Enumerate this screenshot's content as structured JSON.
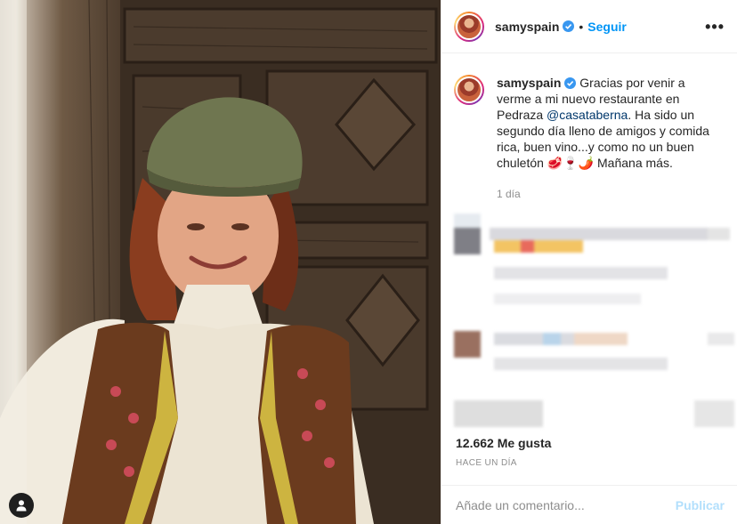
{
  "post": {
    "username": "samyspain",
    "verified": true,
    "separator": "•",
    "follow_label": "Seguir",
    "more_icon": "more-options-icon",
    "more_label": "•••"
  },
  "caption": {
    "username": "samyspain",
    "text_before": " Gracias por venir a verme a mi nuevo restaurante en Pedraza ",
    "mention": "@casataberna",
    "text_after": ". Ha sido un segundo día lleno de amigos y comida rica, buen vino...y como no un buen chuletón ",
    "emoji": "🥩🍷🌶️",
    "text_end": " Mañana más.",
    "time": "1 día"
  },
  "stats": {
    "likes": "12.662 Me gusta",
    "posted_ago": "Hace un día"
  },
  "comment_box": {
    "placeholder": "Añade un comentario...",
    "publish_label": "Publicar"
  },
  "colors": {
    "accent": "#0095f6",
    "publish_disabled": "#b2dffc",
    "text": "#262626",
    "muted": "#8e8e8e"
  }
}
